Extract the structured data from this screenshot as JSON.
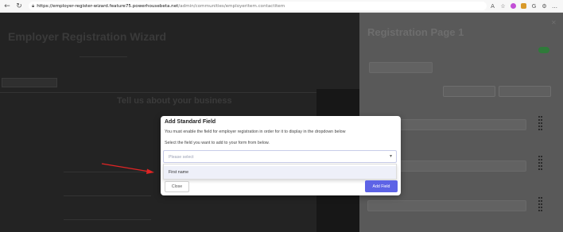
{
  "browser": {
    "url_host": "https://employer-register-wizard.feature75.powerhousebeta.net",
    "url_path": "/admin/communities/employeritem.contactitem",
    "icons": [
      "back-icon",
      "refresh-icon",
      "lock-icon",
      "read-aloud-icon",
      "favorite-icon",
      "extension-icon",
      "collections-icon",
      "profile-icon",
      "settings-icon",
      "more-icon"
    ]
  },
  "background": {
    "page_title": "Employer Registration Wizard",
    "section_heading": "Tell us about your business",
    "right_panel_title": "Registration Page 1"
  },
  "modal": {
    "title": "Add Standard Field",
    "info_text": "You must enable the field for employer registration in order for it to display in the dropdown below",
    "instruction_text": "Select the field you want to add to your form from below.",
    "select_placeholder": "Please select",
    "options": [
      "First name"
    ],
    "close_label": "Close",
    "add_label": "Add Field"
  },
  "colors": {
    "primary_button": "#5d63e6",
    "annotation_arrow": "#e02424"
  }
}
